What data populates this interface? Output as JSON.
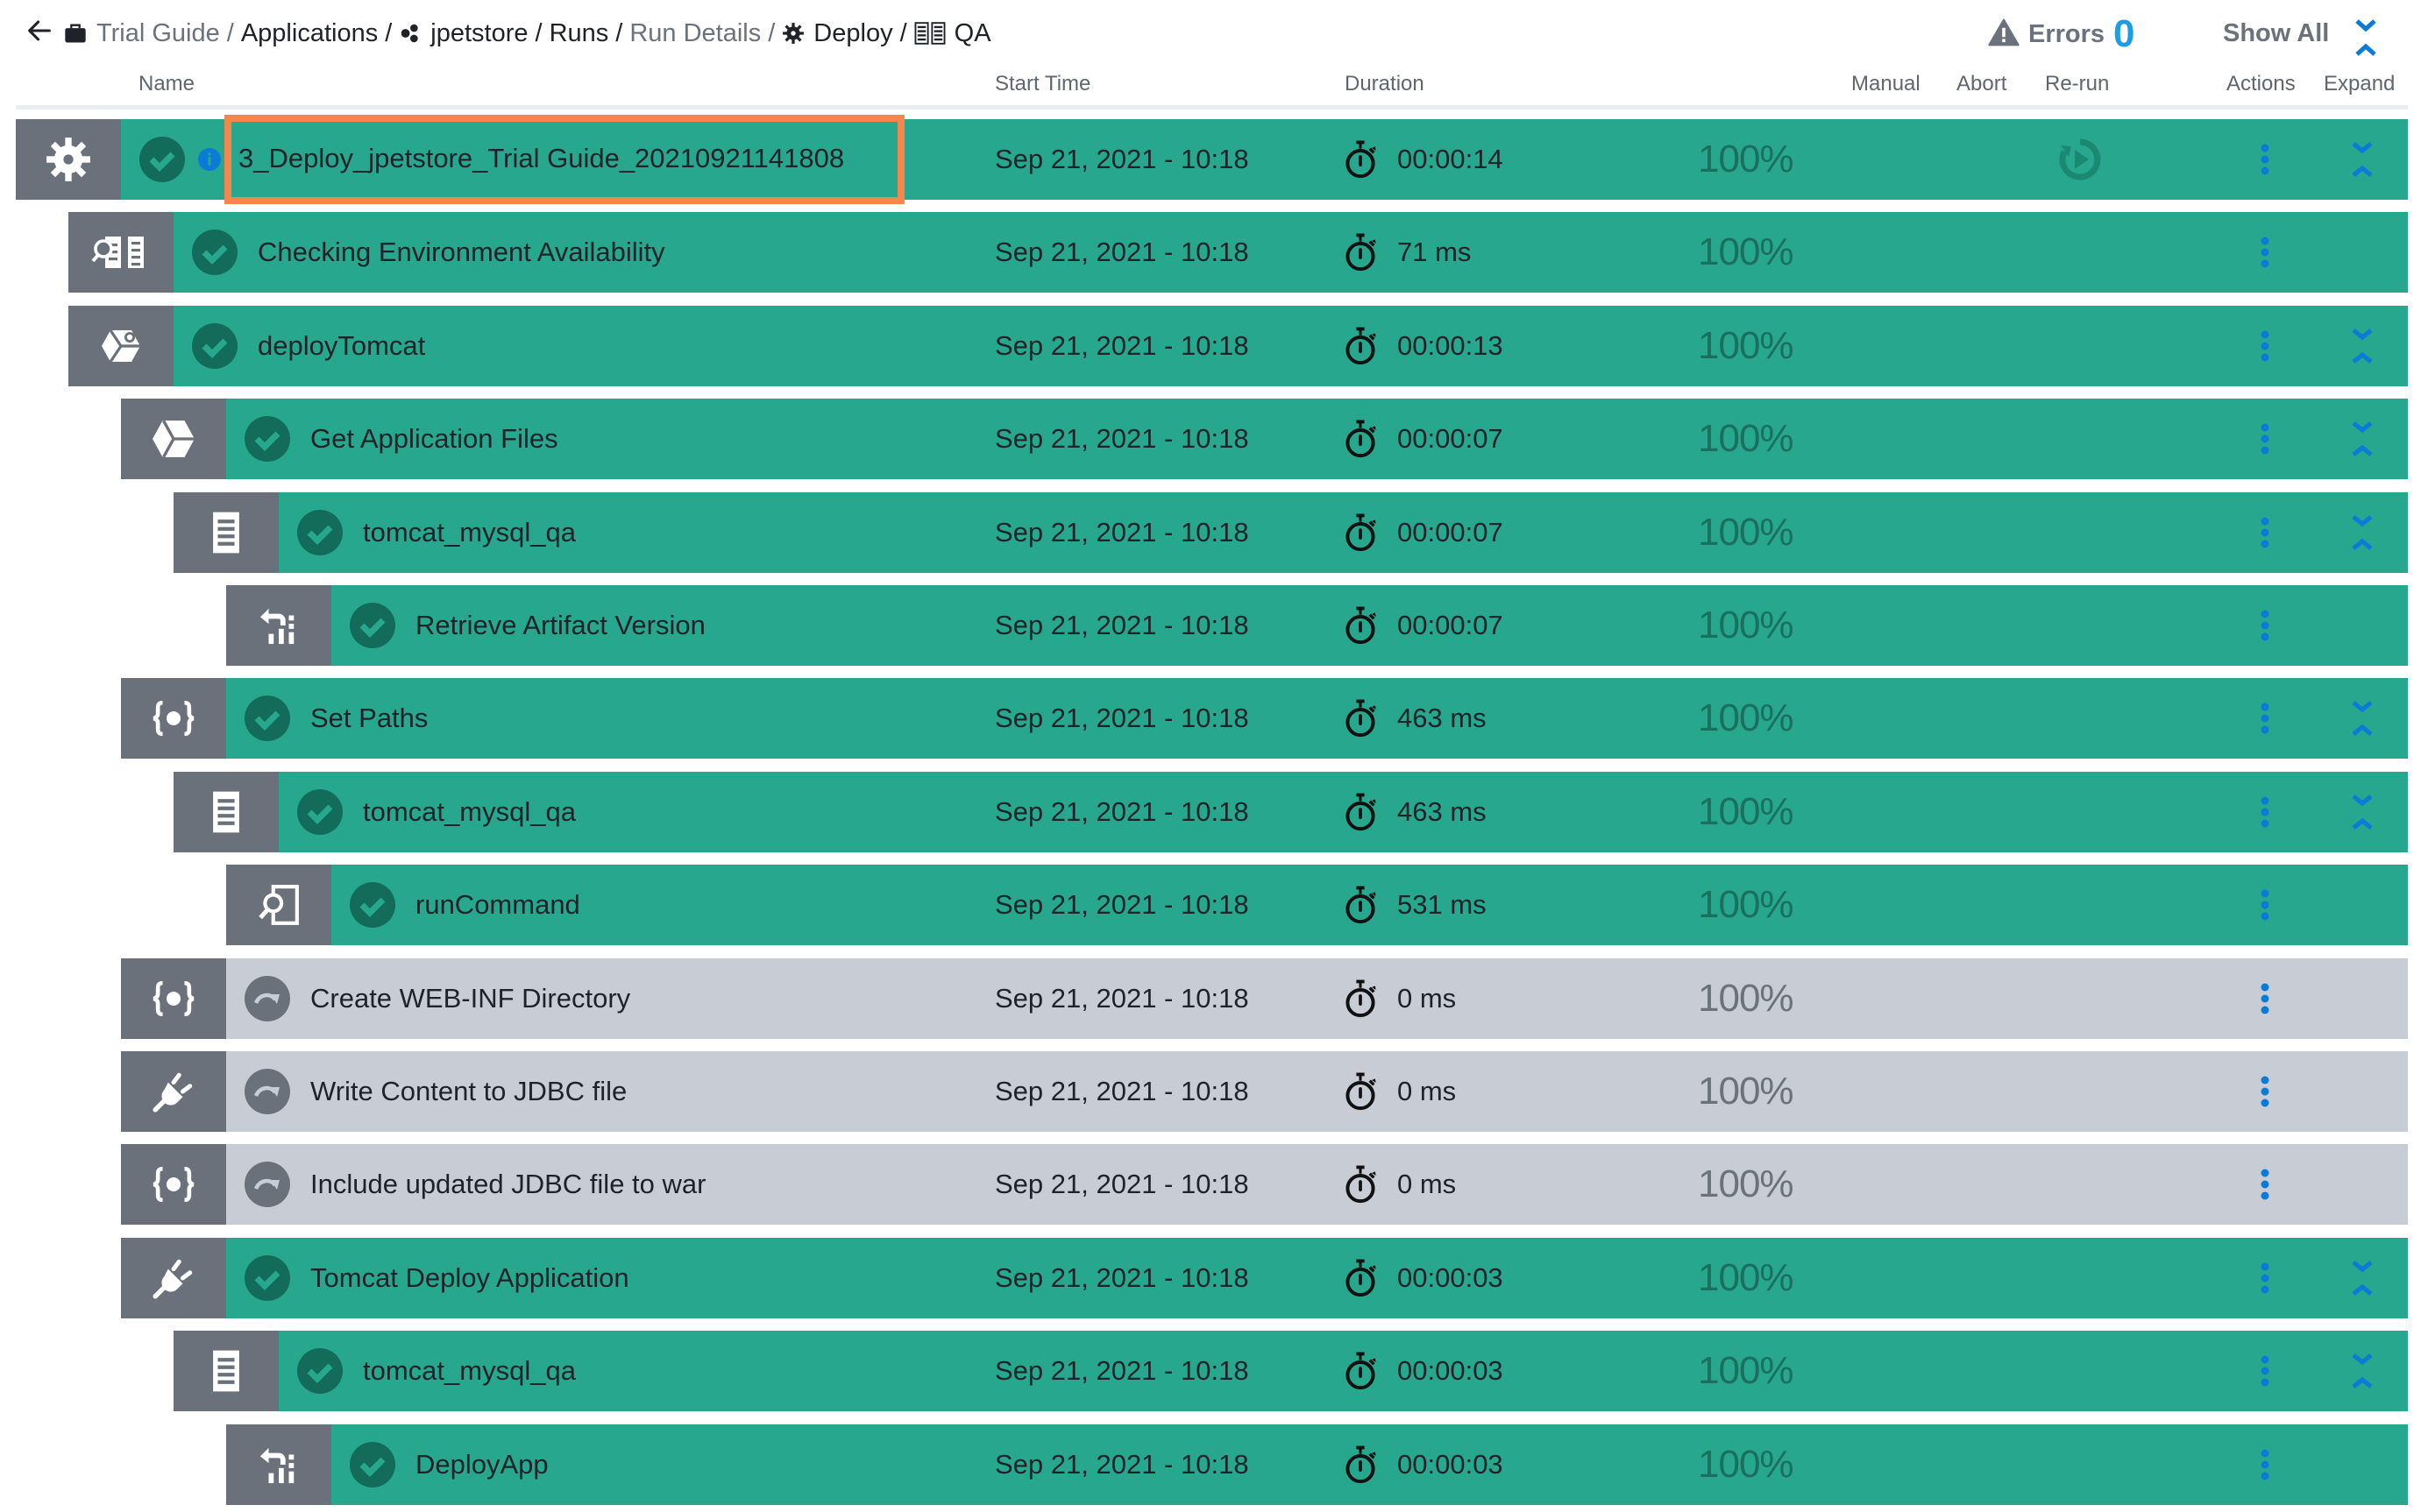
{
  "breadcrumb": [
    {
      "label": "Trial Guide",
      "icon": "briefcase-icon",
      "muted": true
    },
    {
      "label": "Applications",
      "icon": null,
      "muted": false
    },
    {
      "label": "jpetstore",
      "icon": "application-icon",
      "muted": false
    },
    {
      "label": "Runs",
      "icon": null,
      "muted": false
    },
    {
      "label": "Run Details",
      "icon": null,
      "muted": true
    },
    {
      "label": "Deploy",
      "icon": "gear-icon",
      "muted": false
    },
    {
      "label": "QA",
      "icon": "environment-icon",
      "muted": false
    }
  ],
  "errors": {
    "label": "Errors",
    "count": "0",
    "icon": "warning-icon"
  },
  "show_all": {
    "label": "Show All"
  },
  "columns": {
    "name": "Name",
    "start_time": "Start Time",
    "duration": "Duration",
    "manual": "Manual",
    "abort": "Abort",
    "rerun": "Re-run",
    "actions": "Actions",
    "expand": "Expand"
  },
  "colors": {
    "success": "#27a78e",
    "skipped": "#c8cdd5",
    "type_icon_bg": "#6b717b",
    "highlight": "#f7864d",
    "accent": "#0a7bd6",
    "errors_count": "#1c9ee4"
  },
  "rows": [
    {
      "name": "3_Deploy_jpetstore_Trial Guide_20210921141808",
      "level": 0,
      "type_icon": "gear-icon",
      "status": "success",
      "info": true,
      "highlighted": true,
      "start": "Sep 21, 2021 - 10:18",
      "duration": "00:00:14",
      "progress": "100%",
      "rerun": true,
      "expandable": true
    },
    {
      "name": "Checking Environment Availability",
      "level": 1,
      "type_icon": "environment-check-icon",
      "status": "success",
      "start": "Sep 21, 2021 - 10:18",
      "duration": "71 ms",
      "progress": "100%",
      "expandable": false
    },
    {
      "name": "deployTomcat",
      "level": 1,
      "type_icon": "component-process-icon",
      "status": "success",
      "start": "Sep 21, 2021 - 10:18",
      "duration": "00:00:13",
      "progress": "100%",
      "expandable": true
    },
    {
      "name": "Get Application Files",
      "level": 2,
      "type_icon": "cube-icon",
      "status": "success",
      "start": "Sep 21, 2021 - 10:18",
      "duration": "00:00:07",
      "progress": "100%",
      "expandable": true
    },
    {
      "name": "tomcat_mysql_qa",
      "level": 3,
      "type_icon": "resource-icon",
      "status": "success",
      "start": "Sep 21, 2021 - 10:18",
      "duration": "00:00:07",
      "progress": "100%",
      "expandable": true
    },
    {
      "name": "Retrieve Artifact Version",
      "level": 4,
      "type_icon": "artifact-retrieve-icon",
      "status": "success",
      "start": "Sep 21, 2021 - 10:18",
      "duration": "00:00:07",
      "progress": "100%",
      "expandable": false
    },
    {
      "name": "Set Paths",
      "level": 2,
      "type_icon": "variable-icon",
      "status": "success",
      "start": "Sep 21, 2021 - 10:18",
      "duration": "463 ms",
      "progress": "100%",
      "expandable": true
    },
    {
      "name": "tomcat_mysql_qa",
      "level": 3,
      "type_icon": "resource-icon",
      "status": "success",
      "start": "Sep 21, 2021 - 10:18",
      "duration": "463 ms",
      "progress": "100%",
      "expandable": true
    },
    {
      "name": "runCommand",
      "level": 4,
      "type_icon": "command-icon",
      "status": "success",
      "start": "Sep 21, 2021 - 10:18",
      "duration": "531 ms",
      "progress": "100%",
      "expandable": false
    },
    {
      "name": "Create WEB-INF Directory",
      "level": 2,
      "type_icon": "variable-icon",
      "status": "skipped",
      "start": "Sep 21, 2021 - 10:18",
      "duration": "0 ms",
      "progress": "100%",
      "expandable": false
    },
    {
      "name": "Write Content to JDBC file",
      "level": 2,
      "type_icon": "plugin-icon",
      "status": "skipped",
      "start": "Sep 21, 2021 - 10:18",
      "duration": "0 ms",
      "progress": "100%",
      "expandable": false
    },
    {
      "name": "Include updated JDBC file to war",
      "level": 2,
      "type_icon": "variable-icon",
      "status": "skipped",
      "start": "Sep 21, 2021 - 10:18",
      "duration": "0 ms",
      "progress": "100%",
      "expandable": false
    },
    {
      "name": "Tomcat Deploy Application",
      "level": 2,
      "type_icon": "plugin-icon",
      "status": "success",
      "start": "Sep 21, 2021 - 10:18",
      "duration": "00:00:03",
      "progress": "100%",
      "expandable": true
    },
    {
      "name": "tomcat_mysql_qa",
      "level": 3,
      "type_icon": "resource-icon",
      "status": "success",
      "start": "Sep 21, 2021 - 10:18",
      "duration": "00:00:03",
      "progress": "100%",
      "expandable": true
    },
    {
      "name": "DeployApp",
      "level": 4,
      "type_icon": "artifact-retrieve-icon",
      "status": "success",
      "start": "Sep 21, 2021 - 10:18",
      "duration": "00:00:03",
      "progress": "100%",
      "expandable": false
    }
  ]
}
